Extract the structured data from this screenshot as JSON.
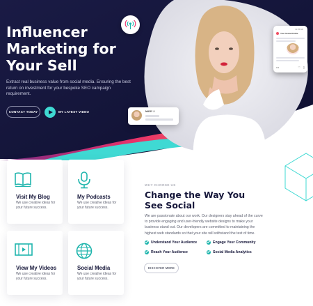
{
  "colors": {
    "hero_bg": "#15163a",
    "accent_teal": "#3fd9d3",
    "accent_pink": "#e8326a",
    "check_green": "#1fb5ad",
    "heading_dark": "#16173a"
  },
  "hero": {
    "title": "Influencer Marketing for Your Sell",
    "subtitle": "Extract real business value from social media. Ensuring the best return on investment for your bespoke SEO campaign requirement.",
    "contact_button": "CONTACT TODAY",
    "video_link": "MY LATEST VIDEO",
    "signal_icon": "broadcast-icon"
  },
  "profile_card": {
    "time": "12:35 AM",
    "title": "Your Social Profile"
  },
  "name_card": {
    "name": "MARY J."
  },
  "features": [
    {
      "icon": "book-icon",
      "title": "Visit My Blog",
      "text": "We use creative ideas for your future success."
    },
    {
      "icon": "microphone-icon",
      "title": "My Podcasts",
      "text": "We use creative ideas for your future success."
    },
    {
      "icon": "video-icon",
      "title": "View My Videos",
      "text": "We use creative ideas for your future success."
    },
    {
      "icon": "globe-icon",
      "title": "Social Media",
      "text": "We use creative ideas for your future success."
    }
  ],
  "about": {
    "kicker": "WHY CHOOSE US",
    "title": "Change the Way You See Social",
    "text": "We are passionate about our work. Our designers stay ahead of the curve to provide engaging and user-friendly website designs to make your business stand out. Our developers are committed to maintaining the highest web standards so that your site will withstand the test of time.",
    "checks": [
      "Understand Your Audience",
      "Engage Your Community",
      "Reach Your Audience",
      "Social Media Analytics"
    ],
    "button": "DISCOVER MORE"
  }
}
